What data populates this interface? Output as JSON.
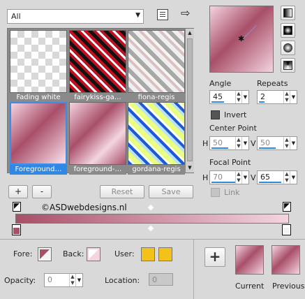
{
  "category": {
    "value": "All"
  },
  "gradients": [
    {
      "name": "Fading white",
      "selected": false
    },
    {
      "name": "fairykiss-ga…",
      "selected": false
    },
    {
      "name": "fiona-regis",
      "selected": false
    },
    {
      "name": "Foreground…",
      "selected": true
    },
    {
      "name": "foreground-…",
      "selected": false
    },
    {
      "name": "gordana-regis",
      "selected": false
    }
  ],
  "toolbar": {
    "add": "+",
    "remove": "-",
    "reset": "Reset",
    "save": "Save"
  },
  "watermark": "©ASDwebdesigns.nl",
  "angle": {
    "label": "Angle",
    "value": "45"
  },
  "repeats": {
    "label": "Repeats",
    "value": "2"
  },
  "invert": {
    "label": "Invert",
    "checked": true
  },
  "center_point": {
    "label": "Center Point",
    "h_label": "H",
    "h": "50",
    "v_label": "V",
    "v": "50"
  },
  "focal_point": {
    "label": "Focal Point",
    "h_label": "H",
    "h": "70",
    "v_label": "V",
    "v": "65"
  },
  "link": {
    "label": "Link"
  },
  "styles": [
    "linear-style-icon",
    "rectangular-style-icon",
    "sunburst-style-icon",
    "radial-style-icon"
  ],
  "bottom": {
    "fore_label": "Fore:",
    "back_label": "Back:",
    "user_label": "User:",
    "opacity_label": "Opacity:",
    "opacity_value": "0",
    "location_label": "Location:",
    "location_value": "0",
    "current_label": "Current",
    "previous_label": "Previous"
  },
  "colors": {
    "foreground": "#a84f68",
    "background": "#f4d4e0",
    "user1": "#f2c21a",
    "user2": "#f2c21a",
    "accent": "#2f87e6"
  }
}
